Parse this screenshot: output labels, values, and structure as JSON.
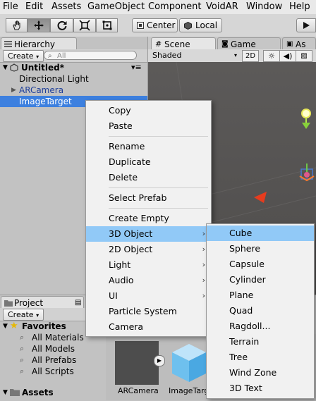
{
  "menubar": [
    "File",
    "Edit",
    "Assets",
    "GameObject",
    "Component",
    "VoidAR",
    "Window",
    "Help"
  ],
  "toolbar": {
    "center_label": "Center",
    "local_label": "Local"
  },
  "hierarchy": {
    "tab_label": "Hierarchy",
    "create_label": "Create",
    "search_placeholder": "All",
    "scene_name": "Untitled*",
    "items": [
      {
        "label": "Directional Light"
      },
      {
        "label": "ARCamera"
      },
      {
        "label": "ImageTarget"
      }
    ]
  },
  "scene": {
    "scene_tab": "Scene",
    "game_tab": "Game",
    "asset_tab": "As",
    "shading": "Shaded",
    "mode_2d": "2D"
  },
  "project": {
    "tab_label": "Project",
    "create_label": "Create",
    "favorites_label": "Favorites",
    "favorites": [
      "All Materials",
      "All Models",
      "All Prefabs",
      "All Scripts"
    ],
    "assets_label": "Assets",
    "thumbs": [
      "ARCamera",
      "ImageTarg"
    ]
  },
  "context_menu": {
    "groups": [
      [
        "Copy",
        "Paste"
      ],
      [
        "Rename",
        "Duplicate",
        "Delete"
      ],
      [
        "Select Prefab"
      ],
      [
        "Create Empty",
        "3D Object",
        "2D Object",
        "Light",
        "Audio",
        "UI",
        "Particle System",
        "Camera"
      ]
    ],
    "highlighted": "3D Object"
  },
  "submenu": {
    "items": [
      "Cube",
      "Sphere",
      "Capsule",
      "Cylinder",
      "Plane",
      "Quad",
      "Ragdoll...",
      "Terrain",
      "Tree",
      "Wind Zone",
      "3D Text"
    ],
    "highlighted": "Cube"
  }
}
